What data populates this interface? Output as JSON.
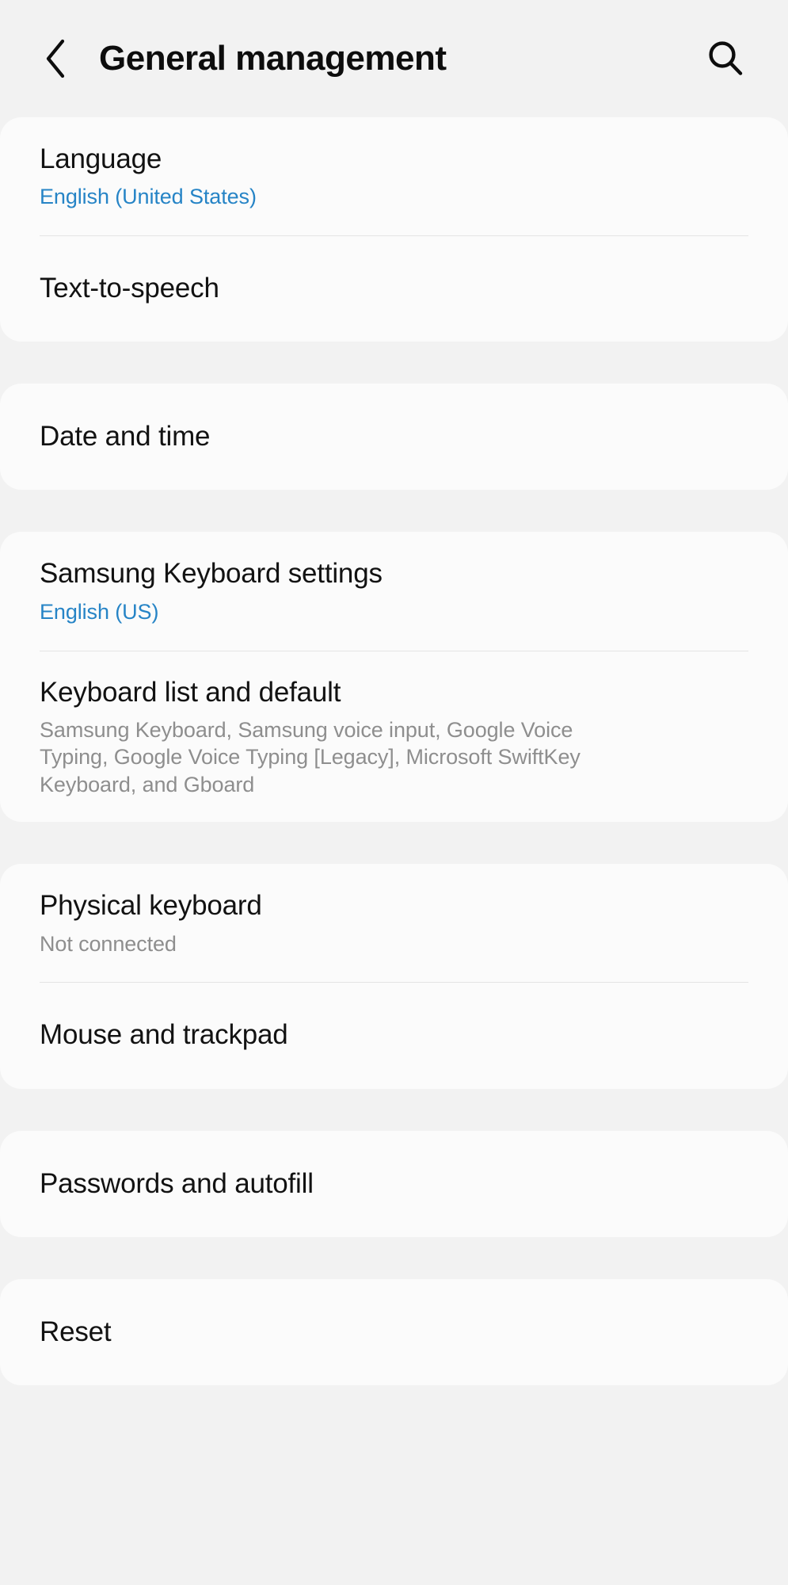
{
  "header": {
    "back_icon": "chevron-left-icon",
    "title": "General management",
    "search_icon": "search-icon"
  },
  "colors": {
    "page_background": "#f2f2f2",
    "card_background": "#fbfbfb",
    "title_text": "#121212",
    "accent_link": "#2684c6",
    "muted_text": "#8e8e8e",
    "divider": "#e4e4e4"
  },
  "sections": [
    {
      "id": "language-section",
      "rows": [
        {
          "id": "language",
          "title": "Language",
          "subtitle": "English (United States)",
          "subtitle_style": "accent"
        },
        {
          "id": "text-to-speech",
          "title": "Text-to-speech",
          "subtitle": "",
          "subtitle_style": "none"
        }
      ]
    },
    {
      "id": "date-section",
      "rows": [
        {
          "id": "date-and-time",
          "title": "Date and time",
          "subtitle": "",
          "subtitle_style": "none"
        }
      ]
    },
    {
      "id": "keyboard-section",
      "rows": [
        {
          "id": "samsung-keyboard-settings",
          "title": "Samsung Keyboard settings",
          "subtitle": "English (US)",
          "subtitle_style": "accent"
        },
        {
          "id": "keyboard-list-and-default",
          "title": "Keyboard list and default",
          "subtitle": "Samsung Keyboard, Samsung voice input, Google Voice Typing, Google Voice Typing [Legacy], Microsoft SwiftKey Keyboard, and Gboard",
          "subtitle_style": "muted"
        }
      ]
    },
    {
      "id": "input-devices-section",
      "rows": [
        {
          "id": "physical-keyboard",
          "title": "Physical keyboard",
          "subtitle": "Not connected",
          "subtitle_style": "muted"
        },
        {
          "id": "mouse-and-trackpad",
          "title": "Mouse and trackpad",
          "subtitle": "",
          "subtitle_style": "none"
        }
      ]
    },
    {
      "id": "passwords-section",
      "rows": [
        {
          "id": "passwords-and-autofill",
          "title": "Passwords and autofill",
          "subtitle": "",
          "subtitle_style": "none"
        }
      ]
    },
    {
      "id": "reset-section",
      "rows": [
        {
          "id": "reset",
          "title": "Reset",
          "subtitle": "",
          "subtitle_style": "none"
        }
      ]
    }
  ]
}
